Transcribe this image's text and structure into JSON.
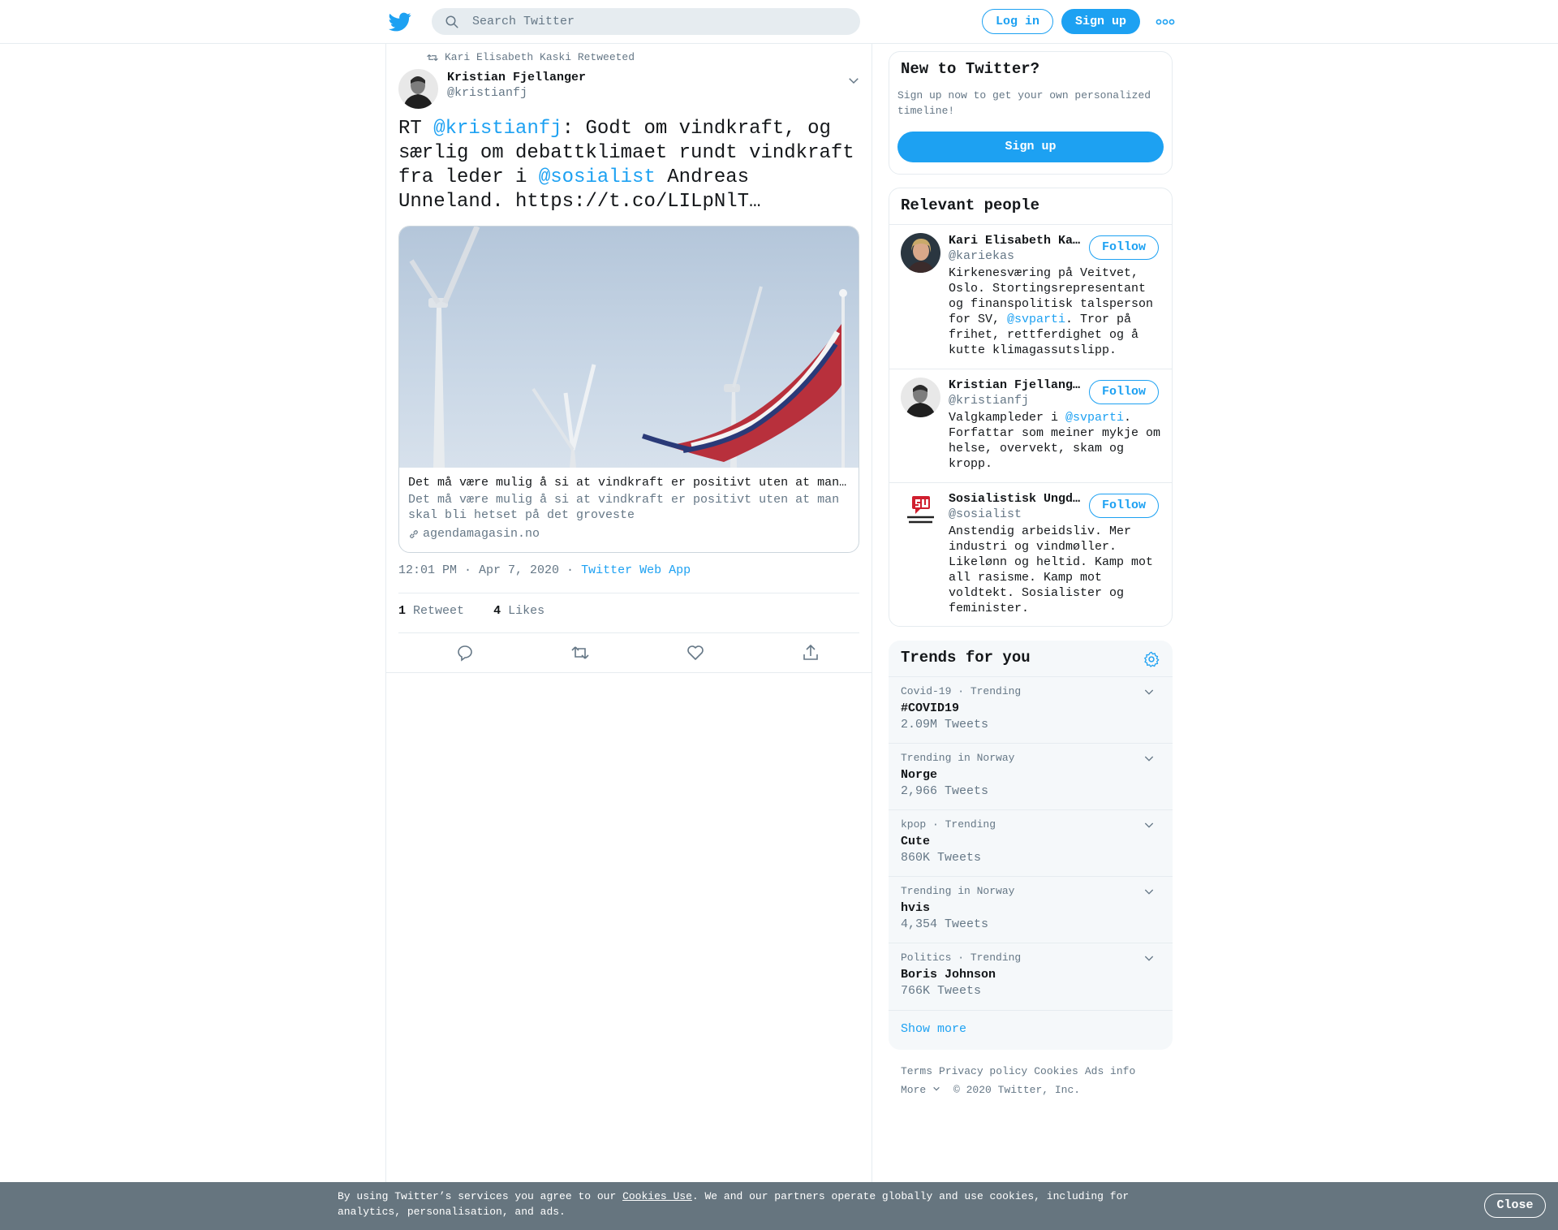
{
  "header": {
    "search_placeholder": "Search Twitter",
    "login_label": "Log in",
    "signup_label": "Sign up"
  },
  "tweet": {
    "retweeted_by": "Kari Elisabeth Kaski Retweeted",
    "author_name": "Kristian Fjellanger",
    "author_handle": "@kristianfj",
    "text_parts": {
      "p1": "RT ",
      "m1": "@kristianfj",
      "p2": ": Godt om vindkraft, og særlig om debattklimaet rundt vindkraft fra leder i ",
      "m2": "@sosialist",
      "p3": " Andreas Unneland. https://t.co/LILpNlT…"
    },
    "card": {
      "title": "Det må være mulig å si at vindkraft er positivt uten at man skal bli hetset på det groveste",
      "description": "Det må være mulig å si at vindkraft er positivt uten at man skal bli hetset på det groveste",
      "domain": "agendamagasin.no"
    },
    "timestamp": "12:01 PM · Apr 7, 2020",
    "separator": " · ",
    "source": "Twitter Web App",
    "retweets_count": "1",
    "retweets_label": "Retweet",
    "likes_count": "4",
    "likes_label": "Likes"
  },
  "new_to_twitter": {
    "title": "New to Twitter?",
    "text": "Sign up now to get your own personalized timeline!",
    "button": "Sign up"
  },
  "relevant_people": {
    "title": "Relevant people",
    "follow_label": "Follow",
    "people": [
      {
        "name": "Kari Elisabeth Kaski",
        "handle": "@kariekas",
        "bio_a": "Kirkenesværing på Veitvet, Oslo. Stortingsrepresentant og finanspolitisk talsperson for SV, ",
        "bio_mention": "@svparti",
        "bio_b": ". Tror på frihet, rettferdighet og å kutte klimagassutslipp."
      },
      {
        "name": "Kristian Fjellanger",
        "handle": "@kristianfj",
        "bio_a": "Valgkampleder i ",
        "bio_mention": "@svparti",
        "bio_b": ". Forfattar som meiner mykje om helse, overvekt, skam og kropp."
      },
      {
        "name": "Sosialistisk Ungdom",
        "handle": "@sosialist",
        "bio": "Anstendig arbeidsliv. Mer industri og vindmøller. Likelønn og heltid. Kamp mot all rasisme. Kamp mot voldtekt. Sosialister og feminister."
      }
    ]
  },
  "trends": {
    "title": "Trends for you",
    "items": [
      {
        "context": "Covid-19 · Trending",
        "name": "#COVID19",
        "count": "2.09M Tweets"
      },
      {
        "context": "Trending in Norway",
        "name": "Norge",
        "count": "2,966 Tweets"
      },
      {
        "context": "kpop · Trending",
        "name": "Cute",
        "count": "860K Tweets"
      },
      {
        "context": "Trending in Norway",
        "name": "hvis",
        "count": "4,354 Tweets"
      },
      {
        "context": "Politics · Trending",
        "name": "Boris Johnson",
        "count": "766K Tweets"
      }
    ],
    "show_more": "Show more"
  },
  "footer": {
    "links": [
      "Terms",
      "Privacy policy",
      "Cookies",
      "Ads info"
    ],
    "more": "More",
    "copyright": "© 2020 Twitter, Inc."
  },
  "cookie_bar": {
    "text_a": "By using Twitter’s services you agree to our ",
    "link": "Cookies Use",
    "text_b": ". We and our partners operate globally and use cookies, including for analytics, personalisation, and ads.",
    "close": "Close"
  },
  "colors": {
    "accent": "#1da1f2",
    "secondary_text": "#657786",
    "border": "#e6ecf0",
    "cookie_bar": "#66757f"
  },
  "icons": [
    "twitter-bird-icon",
    "search-icon",
    "more-dots-icon",
    "retweet-icon",
    "chevron-down-icon",
    "link-icon",
    "reply-icon",
    "like-icon",
    "share-icon",
    "gear-icon"
  ]
}
